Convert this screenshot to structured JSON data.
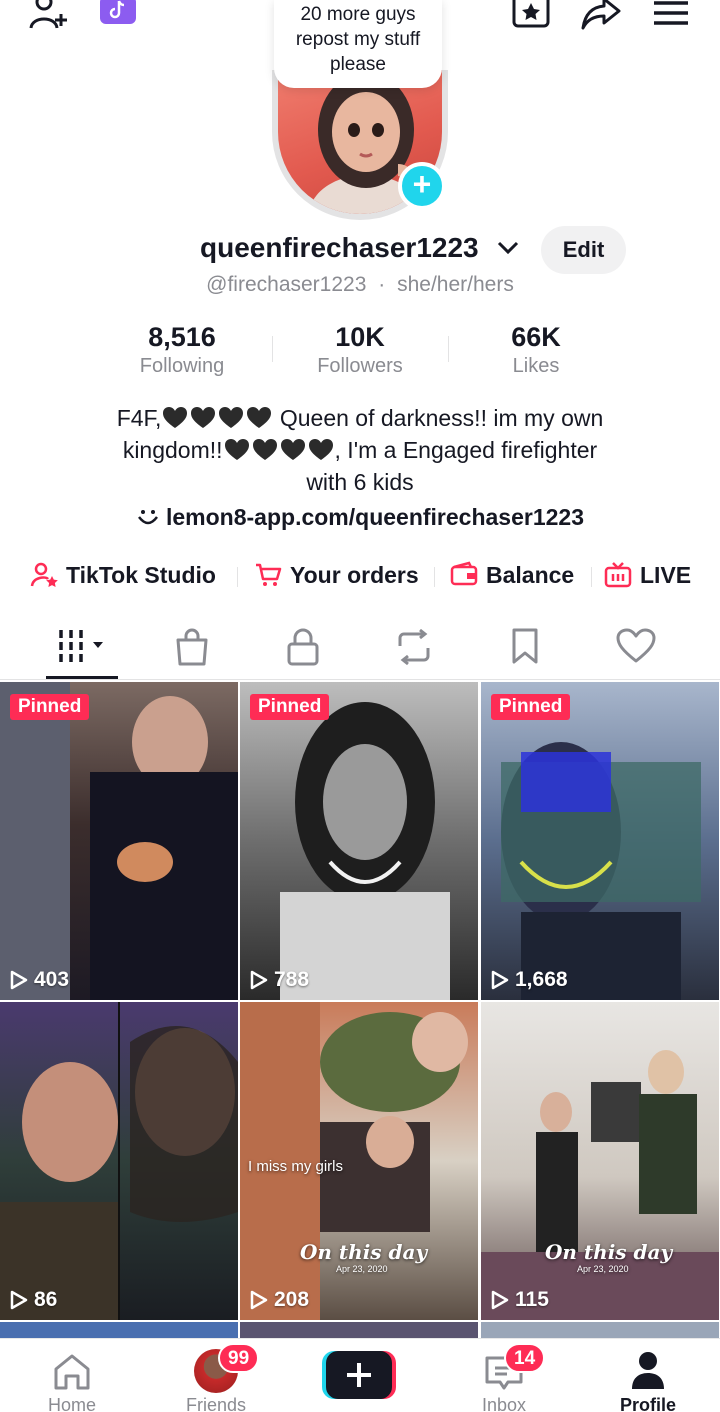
{
  "note": {
    "lines": [
      "20 more guys",
      "repost my stuff",
      "please"
    ]
  },
  "profile": {
    "username": "queenfirechaser1223",
    "handle": "@firechaser1223",
    "separator": "·",
    "pronouns": "she/her/hers",
    "edit_label": "Edit"
  },
  "stats": [
    {
      "value": "8,516",
      "label": "Following"
    },
    {
      "value": "10K",
      "label": "Followers"
    },
    {
      "value": "66K",
      "label": "Likes"
    }
  ],
  "bio": {
    "line1_a": "F4F,",
    "line1_b": " Queen of darkness!! im my own",
    "line2_a": "kingdom!!",
    "line2_b": ", I'm a  Engaged firefighter",
    "line3": "with 6 kids",
    "heart_emoji": "black-heart-icon"
  },
  "link": {
    "url": "lemon8-app.com/queenfirechaser1223"
  },
  "tools": [
    {
      "label": "TikTok Studio",
      "icon": "person-star-icon"
    },
    {
      "label": "Your orders",
      "icon": "cart-icon"
    },
    {
      "label": "Balance",
      "icon": "wallet-icon"
    },
    {
      "label": "LIVE",
      "icon": "tv-icon"
    }
  ],
  "tabs": [
    "videos-grid-icon",
    "shop-bag-icon",
    "lock-icon",
    "repost-icon",
    "bookmark-icon",
    "heart-icon"
  ],
  "videos": [
    {
      "pinned": "Pinned",
      "views": "403"
    },
    {
      "pinned": "Pinned",
      "views": "788"
    },
    {
      "pinned": "Pinned",
      "views": "1,668"
    },
    {
      "pinned": "",
      "views": "86"
    },
    {
      "pinned": "",
      "views": "208",
      "caption": "I miss my girls",
      "stamp": "On this day",
      "stamp_date": "Apr 23, 2020"
    },
    {
      "pinned": "",
      "views": "115",
      "stamp": "On this day",
      "stamp_date": "Apr 23, 2020"
    }
  ],
  "nav": {
    "home": "Home",
    "friends": "Friends",
    "friends_badge": "99",
    "inbox": "Inbox",
    "inbox_badge": "14",
    "profile": "Profile"
  },
  "colors": {
    "accent": "#fe2c55",
    "cyan": "#20d5ec",
    "text": "#161823",
    "muted": "#8a8b91"
  }
}
